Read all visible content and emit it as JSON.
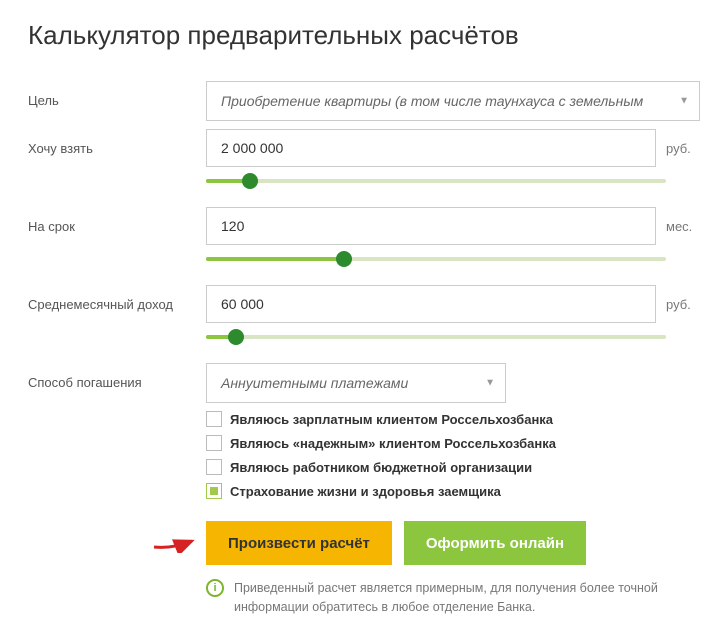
{
  "title": "Калькулятор предварительных расчётов",
  "labels": {
    "purpose": "Цель",
    "amount": "Хочу взять",
    "term": "На срок",
    "income": "Среднемесячный доход",
    "repay": "Способ погашения"
  },
  "purpose": {
    "selected": "Приобретение квартиры (в том числе таунхауса с земельным"
  },
  "amount": {
    "value": "2 000 000",
    "unit": "руб.",
    "pct": 9
  },
  "term": {
    "value": "120",
    "unit": "мес.",
    "pct": 28
  },
  "income": {
    "value": "60 000",
    "unit": "руб.",
    "pct": 6
  },
  "repay": {
    "selected": "Аннуитетными платежами"
  },
  "checks": [
    {
      "label": "Являюсь зарплатным клиентом Россельхозбанка",
      "checked": false
    },
    {
      "label": "Являюсь «надежным» клиентом Россельхозбанка",
      "checked": false
    },
    {
      "label": "Являюсь работником бюджетной организации",
      "checked": false
    },
    {
      "label": "Страхование жизни и здоровья заемщика",
      "checked": true
    }
  ],
  "buttons": {
    "calc": "Произвести расчёт",
    "apply": "Оформить онлайн"
  },
  "disclaimer": "Приведенный расчет является примерным, для получения более точной информации обратитесь в любое отделение Банка."
}
